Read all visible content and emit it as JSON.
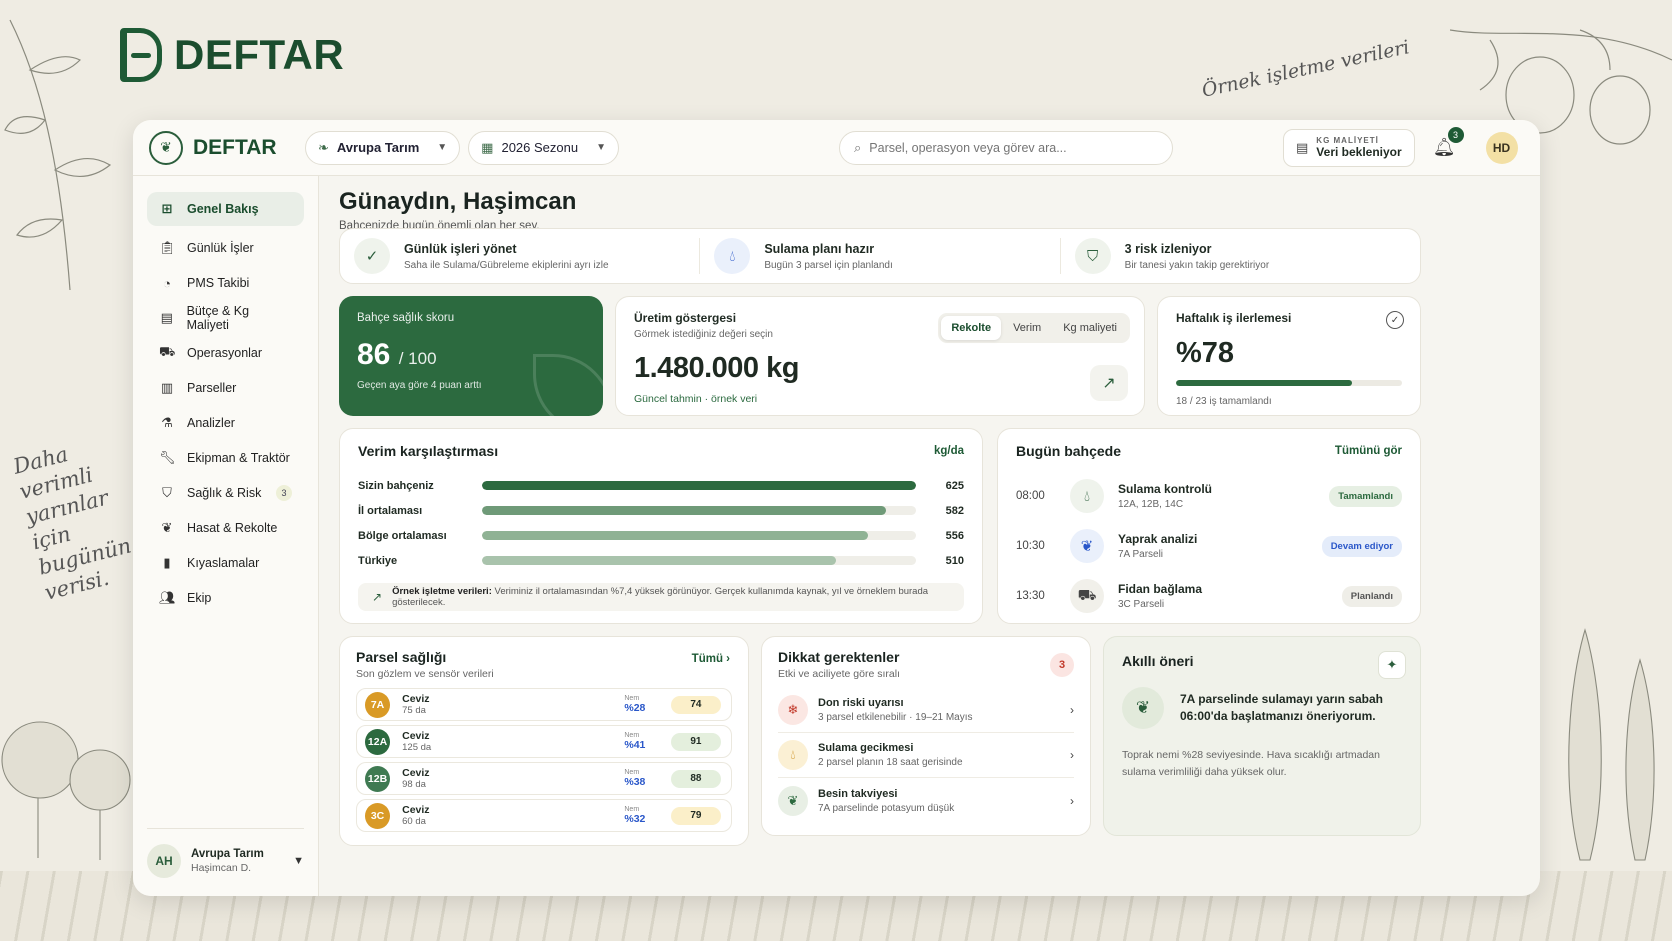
{
  "brand": {
    "name": "DEFTAR"
  },
  "annotations": {
    "sample_note": "Örnek işletme verileri",
    "side_note": "Daha verimli yarınlar için bugünün verisi."
  },
  "topbar": {
    "logo": "DEFTAR",
    "org_select": "Avrupa Tarım",
    "season_select": "2026 Sezonu",
    "search_placeholder": "Parsel, operasyon veya görev ara...",
    "kg_cost_label": "KG MALİYETİ",
    "kg_cost_value": "Veri bekleniyor",
    "notification_count": "3",
    "user_initials": "HD"
  },
  "sidebar": {
    "items": [
      {
        "label": "Genel Bakış",
        "icon": "grid-icon",
        "active": true
      },
      {
        "label": "Günlük İşler",
        "icon": "clipboard-icon"
      },
      {
        "label": "PMS Takibi",
        "icon": "gauge-icon"
      },
      {
        "label": "Bütçe & Kg Maliyeti",
        "icon": "wallet-icon"
      },
      {
        "label": "Operasyonlar",
        "icon": "tractor-icon"
      },
      {
        "label": "Parseller",
        "icon": "map-icon"
      },
      {
        "label": "Analizler",
        "icon": "flask-icon"
      },
      {
        "label": "Ekipman & Traktör",
        "icon": "wrench-icon"
      },
      {
        "label": "Sağlık & Risk",
        "icon": "shield-icon",
        "count": "3"
      },
      {
        "label": "Hasat & Rekolte",
        "icon": "wheat-icon"
      },
      {
        "label": "Kıyaslamalar",
        "icon": "chart-icon"
      },
      {
        "label": "Ekip",
        "icon": "users-icon"
      }
    ],
    "user": {
      "initials": "AH",
      "org": "Avrupa Tarım",
      "name": "Haşimcan D."
    }
  },
  "greeting": {
    "title": "Günaydın, Haşimcan",
    "subtitle": "Bahçenizde bugün önemli olan her şey."
  },
  "summary_strip": [
    {
      "title": "Günlük işleri yönet",
      "desc": "Saha ile Sulama/Gübreleme ekiplerini ayrı izle",
      "icon": "clipboard-check-icon"
    },
    {
      "title": "Sulama planı hazır",
      "desc": "Bugün 3 parsel için planlandı",
      "icon": "water-drop-icon"
    },
    {
      "title": "3 risk izleniyor",
      "desc": "Bir tanesi yakın takip gerektiriyor",
      "icon": "shield-check-icon"
    }
  ],
  "health_card": {
    "label": "Bahçe sağlık skoru",
    "score": "86",
    "max": "/ 100",
    "note": "Geçen aya göre 4 puan arttı"
  },
  "production_card": {
    "title": "Üretim göstergesi",
    "subtitle": "Görmek istediğiniz değeri seçin",
    "value": "1.480.000 kg",
    "note": "Güncel tahmin · örnek veri",
    "tabs": [
      "Rekolte",
      "Verim",
      "Kg maliyeti"
    ],
    "active_tab": "Rekolte"
  },
  "weekly_card": {
    "title": "Haftalık iş ilerlemesi",
    "percent": "%78",
    "progress": 0.78,
    "note": "18 / 23 iş tamamlandı"
  },
  "yield_card": {
    "title": "Verim karşılaştırması",
    "unit": "kg/da",
    "note_bold": "Örnek işletme verileri:",
    "note_text": "Veriminiz il ortalamasından %7,4 yüksek görünüyor. Gerçek kullanımda kaynak, yıl ve örneklem burada gösterilecek."
  },
  "chart_data": {
    "type": "bar",
    "orientation": "horizontal",
    "title": "Verim karşılaştırması",
    "unit": "kg/da",
    "categories": [
      "Sizin bahçeniz",
      "İl ortalaması",
      "Bölge ortalaması",
      "Türkiye"
    ],
    "values": [
      625,
      582,
      556,
      510
    ],
    "colors": [
      "#2c6a3f",
      "#6f9a78",
      "#8fb294",
      "#a9c3ac"
    ],
    "xlim": [
      0,
      625
    ]
  },
  "today_card": {
    "title": "Bugün bahçede",
    "link": "Tümünü gör",
    "rows": [
      {
        "time": "08:00",
        "title": "Sulama kontrolü",
        "desc": "12A, 12B, 14C",
        "status": "Tamamlandı",
        "icon": "water-drop-icon",
        "status_color": "#e6efe3",
        "status_text_color": "#2c6a3f"
      },
      {
        "time": "10:30",
        "title": "Yaprak analizi",
        "desc": "7A Parseli",
        "status": "Devam ediyor",
        "icon": "sprout-icon",
        "status_color": "#e4ecfa",
        "status_text_color": "#2a57c9"
      },
      {
        "time": "13:30",
        "title": "Fidan bağlama",
        "desc": "3C Parseli",
        "status": "Planlandı",
        "icon": "tractor-icon",
        "status_color": "#efeee8",
        "status_text_color": "#555555"
      }
    ]
  },
  "parcel_card": {
    "title": "Parsel sağlığı",
    "subtitle": "Son gözlem ve sensör verileri",
    "link": "Tümü ›",
    "moisture_label": "Nem",
    "rows": [
      {
        "code": "7A",
        "crop": "Ceviz",
        "area": "75 da",
        "moisture": "%28",
        "score": "74",
        "code_color": "#d99a26",
        "score_bg": "#fbefc9"
      },
      {
        "code": "12A",
        "crop": "Ceviz",
        "area": "125 da",
        "moisture": "%41",
        "score": "91",
        "code_color": "#2c6a3f",
        "score_bg": "#e4efdd"
      },
      {
        "code": "12B",
        "crop": "Ceviz",
        "area": "98 da",
        "moisture": "%38",
        "score": "88",
        "code_color": "#3f7a52",
        "score_bg": "#e4efdd"
      },
      {
        "code": "3C",
        "crop": "Ceviz",
        "area": "60 da",
        "moisture": "%32",
        "score": "79",
        "code_color": "#d99a26",
        "score_bg": "#fbefc9"
      }
    ]
  },
  "attention_card": {
    "title": "Dikkat gerektenler",
    "subtitle": "Etki ve aciliyete göre sıralı",
    "count": "3",
    "rows": [
      {
        "title": "Don riski uyarısı",
        "desc": "3 parsel etkilenebilir · 19–21 Mayıs",
        "icon": "frost-icon",
        "icon_bg": "#fbe7e3",
        "icon_color": "#c23a2b"
      },
      {
        "title": "Sulama gecikmesi",
        "desc": "2 parsel planın 18 saat gerisinde",
        "icon": "water-drop-icon",
        "icon_bg": "#fbf0d4",
        "icon_color": "#c98a14"
      },
      {
        "title": "Besin takviyesi",
        "desc": "7A parselinde potasyum düşük",
        "icon": "sprout-icon",
        "icon_bg": "#e8efe5",
        "icon_color": "#2c6a3f"
      }
    ]
  },
  "smart_card": {
    "title": "Akıllı öneri",
    "message": "7A parselinde sulamayı yarın sabah 06:00'da başlatmanızı öneriyorum.",
    "description": "Toprak nemi %28 seviyesinde. Hava sıcaklığı artmadan sulama verimliliği daha yüksek olur."
  }
}
